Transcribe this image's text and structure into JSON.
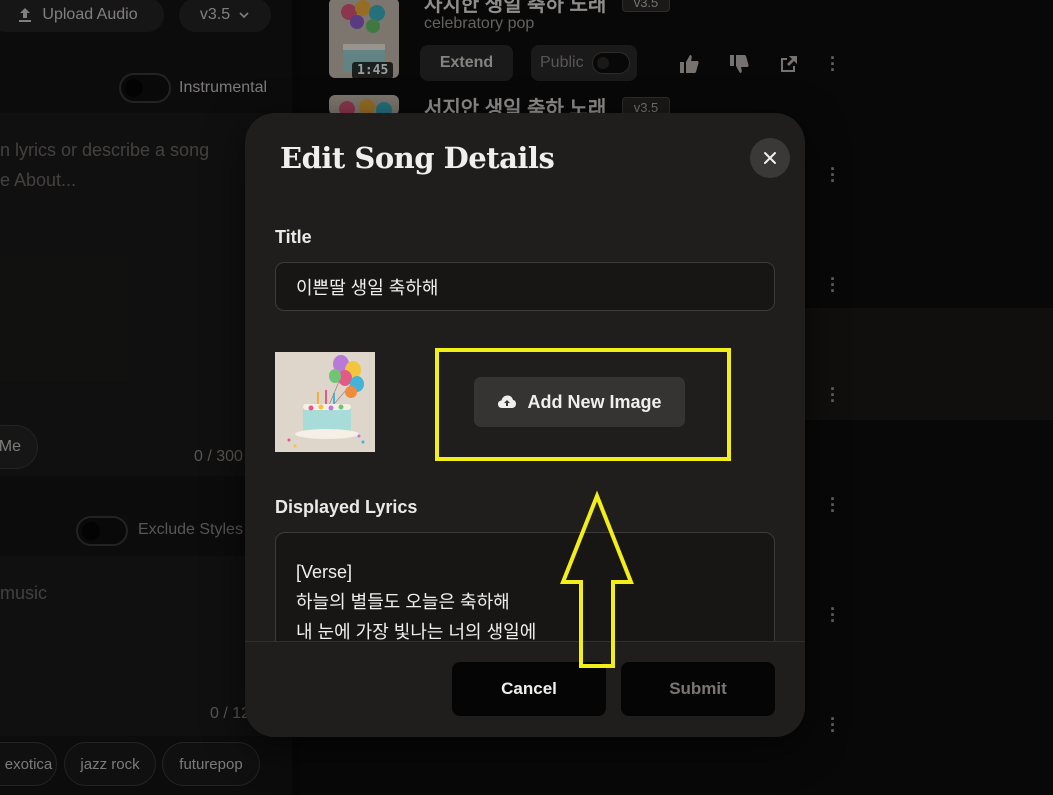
{
  "left_panel": {
    "upload_label": "Upload Audio",
    "version_label": "v3.5",
    "instrumental_label": "Instrumental",
    "lyrics_placeholder_line1": "n lyrics or describe a song",
    "lyrics_placeholder_line2": "e About...",
    "me_button_label": "Me",
    "lyrics_counter": "0 / 300",
    "exclude_label": "Exclude Styles",
    "style_text": "music",
    "style_counter": "0 / 12",
    "tags": [
      "exotica",
      "jazz rock",
      "futurepop"
    ]
  },
  "song_list": {
    "songs": [
      {
        "title": "사치한 생일 축하 노래",
        "version": "v3.5",
        "genre": "celebratory pop",
        "duration": "1:45",
        "extend_label": "Extend",
        "public_label": "Public"
      },
      {
        "title": "서지안 생일 축하 노래",
        "version": "v3.5"
      }
    ]
  },
  "modal": {
    "title": "Edit Song Details",
    "title_label": "Title",
    "title_value": "이쁜딸 생일 축하해",
    "add_image_label": "Add New Image",
    "lyrics_label": "Displayed Lyrics",
    "lyrics_lines": [
      "[Verse]",
      "하늘의 별들도 오늘은 축하해",
      "내 눈에 가장 빛나는 너의 생일에"
    ],
    "cancel_label": "Cancel",
    "submit_label": "Submit"
  },
  "annotation": {
    "highlight_color": "#f3ee18"
  },
  "colors": {
    "modal_bg": "#1f1e1d",
    "button_bg": "#050505",
    "input_bg": "#171615"
  }
}
